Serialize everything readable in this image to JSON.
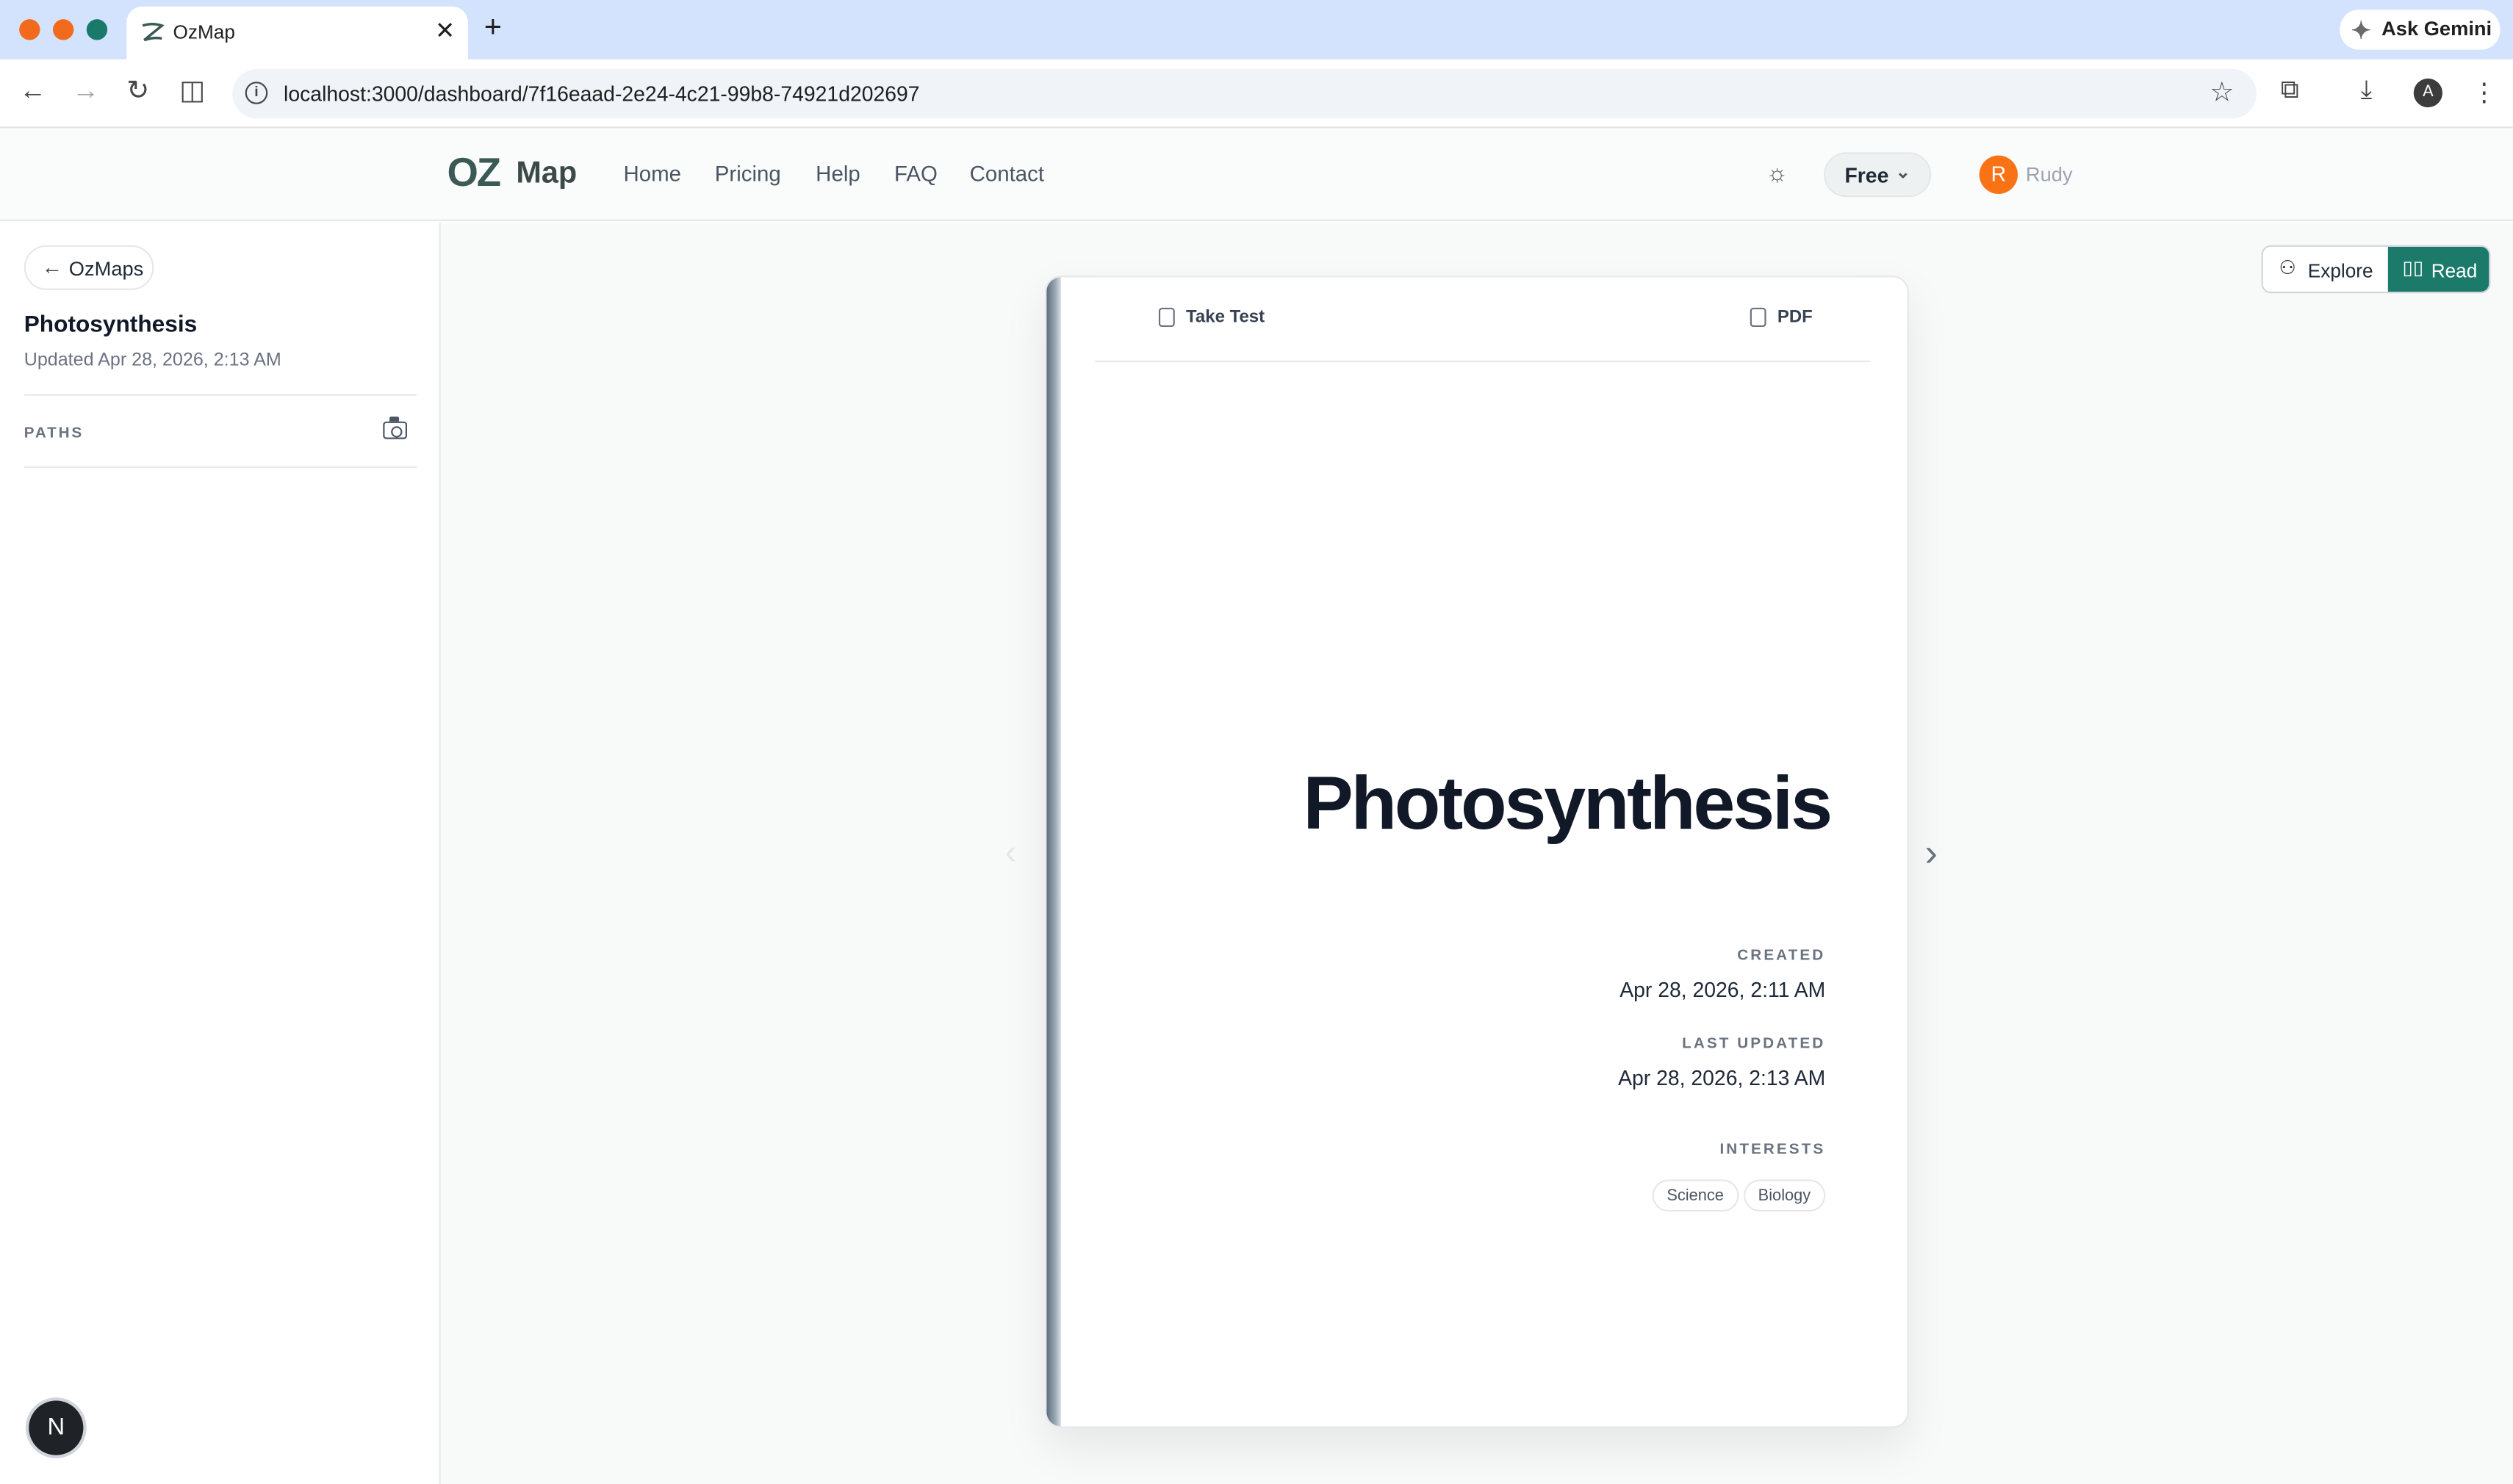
{
  "browser": {
    "tab_title": "OzMap",
    "url": "localhost:3000/dashboard/7f16eaad-2e24-4c21-99b8-74921d202697",
    "ask_gemini": "Ask Gemini",
    "profile_initial": "A"
  },
  "header": {
    "logo_oz": "OZ",
    "logo_map": "Map",
    "nav": [
      "Home",
      "Pricing",
      "Help",
      "FAQ",
      "Contact"
    ],
    "plan": "Free",
    "user_initial": "R",
    "user_name": "Rudy"
  },
  "sidebar": {
    "back_label": "OzMaps",
    "title": "Photosynthesis",
    "updated": "Updated Apr 28, 2026, 2:13 AM",
    "paths_label": "PATHS",
    "badge": "N"
  },
  "main": {
    "explore_label": "Explore",
    "read_label": "Read",
    "take_test_label": "Take Test",
    "pdf_label": "PDF",
    "book_title": "Photosynthesis",
    "created_label": "CREATED",
    "created_value": "Apr 28, 2026, 2:11 AM",
    "last_updated_label": "LAST UPDATED",
    "last_updated_value": "Apr 28, 2026, 2:13 AM",
    "interests_label": "INTERESTS",
    "interests": [
      "Science",
      "Biology"
    ]
  },
  "colors": {
    "accent": "#1c7a6a",
    "avatar": "#f97316",
    "tabstrip": "#d3e3fd"
  }
}
